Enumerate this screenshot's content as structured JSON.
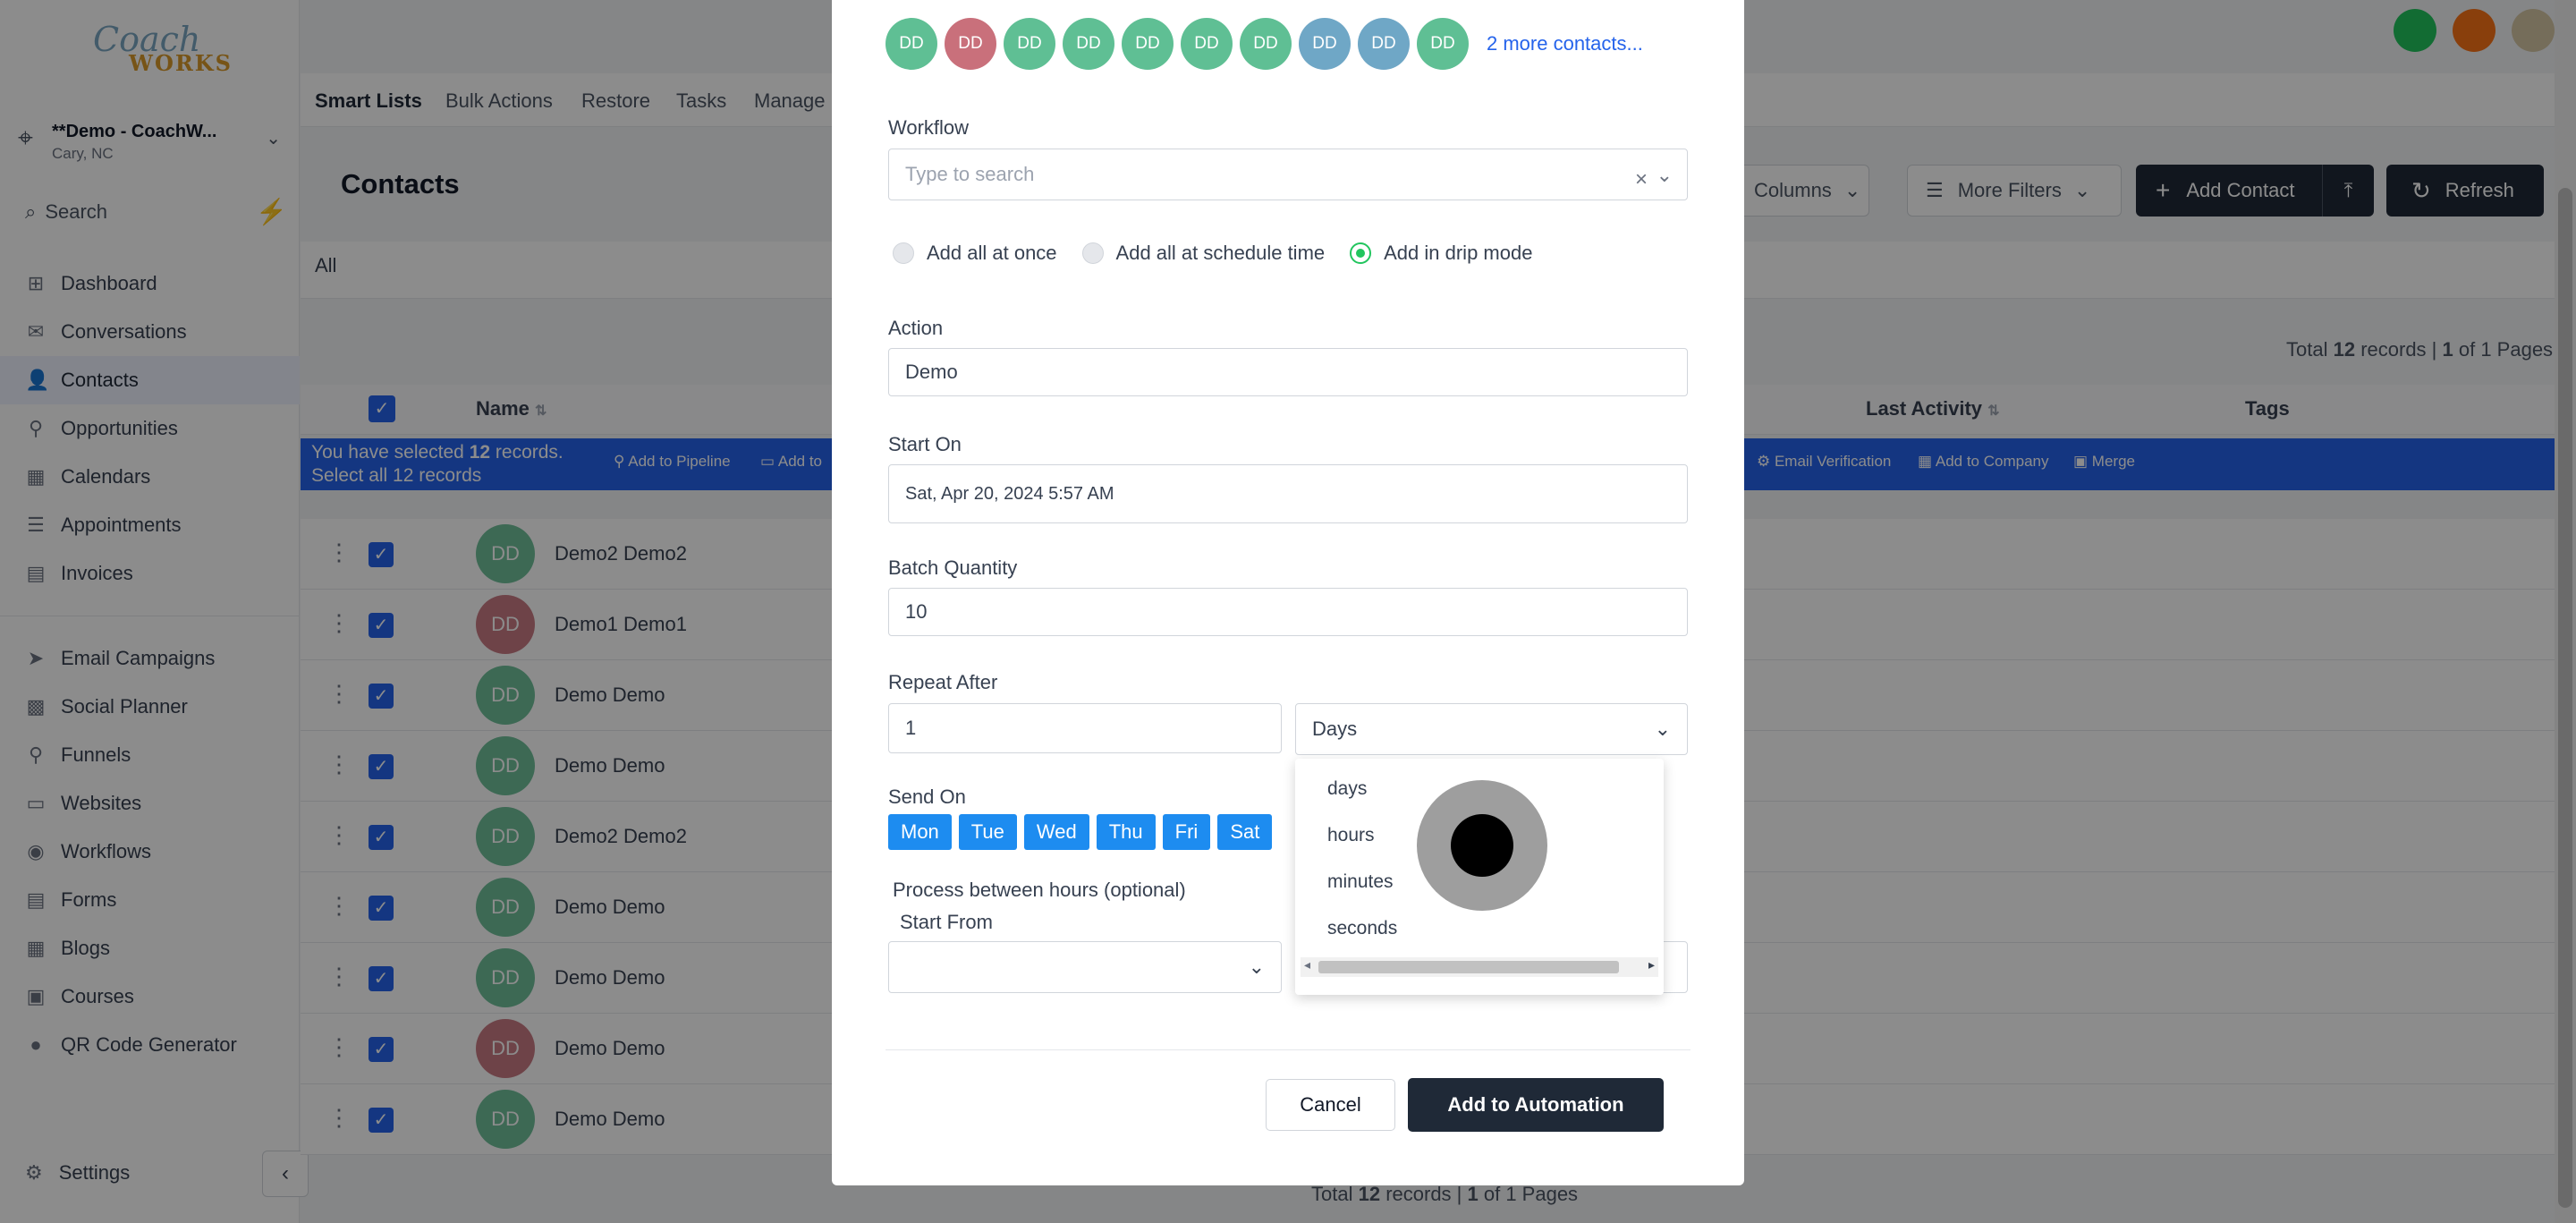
{
  "sidebar": {
    "logo_text": "Coach",
    "logo_sub": "WORKS",
    "location_name": "**Demo - CoachW...",
    "location_sub": "Cary, NC",
    "search_label": "Search",
    "items": [
      {
        "label": "Dashboard",
        "icon": "⊞"
      },
      {
        "label": "Conversations",
        "icon": "✉"
      },
      {
        "label": "Contacts",
        "icon": "👤"
      },
      {
        "label": "Opportunities",
        "icon": "⚲"
      },
      {
        "label": "Calendars",
        "icon": "▦"
      },
      {
        "label": "Appointments",
        "icon": "☰"
      },
      {
        "label": "Invoices",
        "icon": "▤"
      }
    ],
    "items2": [
      {
        "label": "Email Campaigns",
        "icon": "➤"
      },
      {
        "label": "Social Planner",
        "icon": "▩"
      },
      {
        "label": "Funnels",
        "icon": "⚲"
      },
      {
        "label": "Websites",
        "icon": "▭"
      },
      {
        "label": "Workflows",
        "icon": "◉"
      },
      {
        "label": "Forms",
        "icon": "▤"
      },
      {
        "label": "Blogs",
        "icon": "▦"
      },
      {
        "label": "Courses",
        "icon": "▣"
      },
      {
        "label": "QR Code Generator",
        "icon": "●"
      }
    ],
    "settings_label": "Settings"
  },
  "topnav": {
    "tabs": [
      "Smart Lists",
      "Bulk Actions",
      "Restore",
      "Tasks",
      "Manage"
    ]
  },
  "page": {
    "title": "Contacts",
    "columns_label": "Columns",
    "more_filters_label": "More Filters",
    "add_contact_label": "Add Contact",
    "refresh_label": "Refresh",
    "all_tab": "All",
    "total_top_prefix": "Total ",
    "total_count": "12",
    "total_top_mid": " records | ",
    "total_page": "1",
    "total_top_suffix": " of 1 Pages",
    "total_bottom_mid": " records | ",
    "total_bottom_suffix": " of 1 Pages"
  },
  "table": {
    "headers": {
      "name": "Name",
      "last_activity": "Last Activity",
      "tags": "Tags"
    },
    "selection": {
      "line1_prefix": "You have selected ",
      "count": "12",
      "line1_suffix": " records.",
      "line2": "Select all 12 records",
      "actions": [
        "Add to Pipeline",
        "Add to",
        "Email Verification",
        "Add to Company",
        "Merge"
      ]
    },
    "rows": [
      {
        "initials": "DD",
        "name": "Demo2 Demo2",
        "color": "#6fbf9a"
      },
      {
        "initials": "DD",
        "name": "Demo1 Demo1",
        "color": "#c97a83"
      },
      {
        "initials": "DD",
        "name": "Demo Demo",
        "color": "#6fbf9a"
      },
      {
        "initials": "DD",
        "name": "Demo Demo",
        "color": "#6fbf9a"
      },
      {
        "initials": "DD",
        "name": "Demo2 Demo2",
        "color": "#6fbf9a"
      },
      {
        "initials": "DD",
        "name": "Demo Demo",
        "color": "#6fbf9a"
      },
      {
        "initials": "DD",
        "name": "Demo Demo",
        "color": "#6fbf9a"
      },
      {
        "initials": "DD",
        "name": "Demo Demo",
        "color": "#c97a83"
      },
      {
        "initials": "DD",
        "name": "Demo Demo",
        "color": "#6fbf9a"
      }
    ]
  },
  "modal": {
    "avatars": [
      {
        "initials": "DD",
        "color": "#5fbf94"
      },
      {
        "initials": "DD",
        "color": "#c9707b"
      },
      {
        "initials": "DD",
        "color": "#5fbf94"
      },
      {
        "initials": "DD",
        "color": "#5fbf94"
      },
      {
        "initials": "DD",
        "color": "#5fbf94"
      },
      {
        "initials": "DD",
        "color": "#5fbf94"
      },
      {
        "initials": "DD",
        "color": "#5fbf94"
      },
      {
        "initials": "DD",
        "color": "#6fa7c6"
      },
      {
        "initials": "DD",
        "color": "#6fa7c6"
      },
      {
        "initials": "DD",
        "color": "#5fbf94"
      }
    ],
    "more_contacts": "2 more contacts...",
    "workflow_label": "Workflow",
    "workflow_placeholder": "Type to search",
    "radio_options": [
      "Add all at once",
      "Add all at schedule time",
      "Add in drip mode"
    ],
    "selected_radio": "Add in drip mode",
    "action_label": "Action",
    "action_value": "Demo",
    "start_on_label": "Start On",
    "start_on_value": "Sat, Apr 20, 2024 5:57 AM",
    "batch_label": "Batch Quantity",
    "batch_value": "10",
    "repeat_label": "Repeat After",
    "repeat_value": "1",
    "repeat_unit": "Days",
    "unit_options": [
      "days",
      "hours",
      "minutes",
      "seconds"
    ],
    "send_on_label": "Send On",
    "days": [
      "Mon",
      "Tue",
      "Wed",
      "Thu",
      "Fri",
      "Sat"
    ],
    "process_label": "Process between hours (optional)",
    "start_from_label": "Start From",
    "cancel_label": "Cancel",
    "submit_label": "Add to Automation"
  },
  "colors": {
    "primary": "#2563eb",
    "dark_button": "#1f2937",
    "day_chip": "#1d8cf0",
    "radio_active": "#22c55e"
  }
}
